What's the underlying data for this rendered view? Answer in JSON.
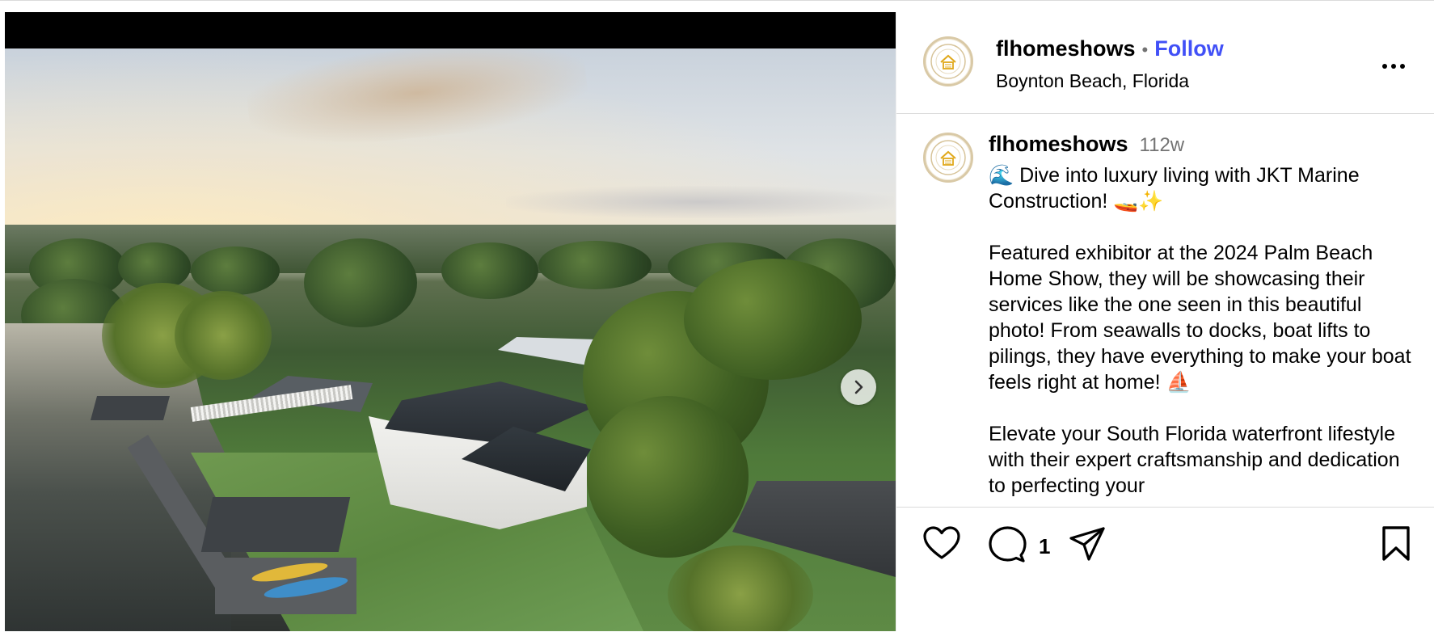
{
  "post": {
    "account": {
      "username": "flhomeshows",
      "follow_label": "Follow",
      "separator": "•",
      "location": "Boynton Beach, Florida",
      "avatar_icon": "house-logo-icon"
    },
    "caption": {
      "username": "flhomeshows",
      "age": "112w",
      "text": "🌊 Dive into luxury living with JKT Marine Construction! 🚤✨\n\nFeatured exhibitor at the 2024 Palm Beach Home Show, they will be showcasing their services like the one seen in this beautiful photo! From seawalls to docks, boat lifts to pilings, they have everything to make your boat feels right at home! ⛵\n\nElevate your South Florida waterfront lifestyle with their expert craftsmanship and dedication to perfecting your"
    },
    "actions": {
      "comment_count": "1",
      "icons": [
        "heart-icon",
        "comment-icon",
        "share-icon",
        "bookmark-icon"
      ]
    },
    "media": {
      "next_icon": "chevron-right-icon"
    }
  },
  "colors": {
    "follow": "#4150f7",
    "muted": "#737373",
    "divider": "#dbdbdb"
  }
}
